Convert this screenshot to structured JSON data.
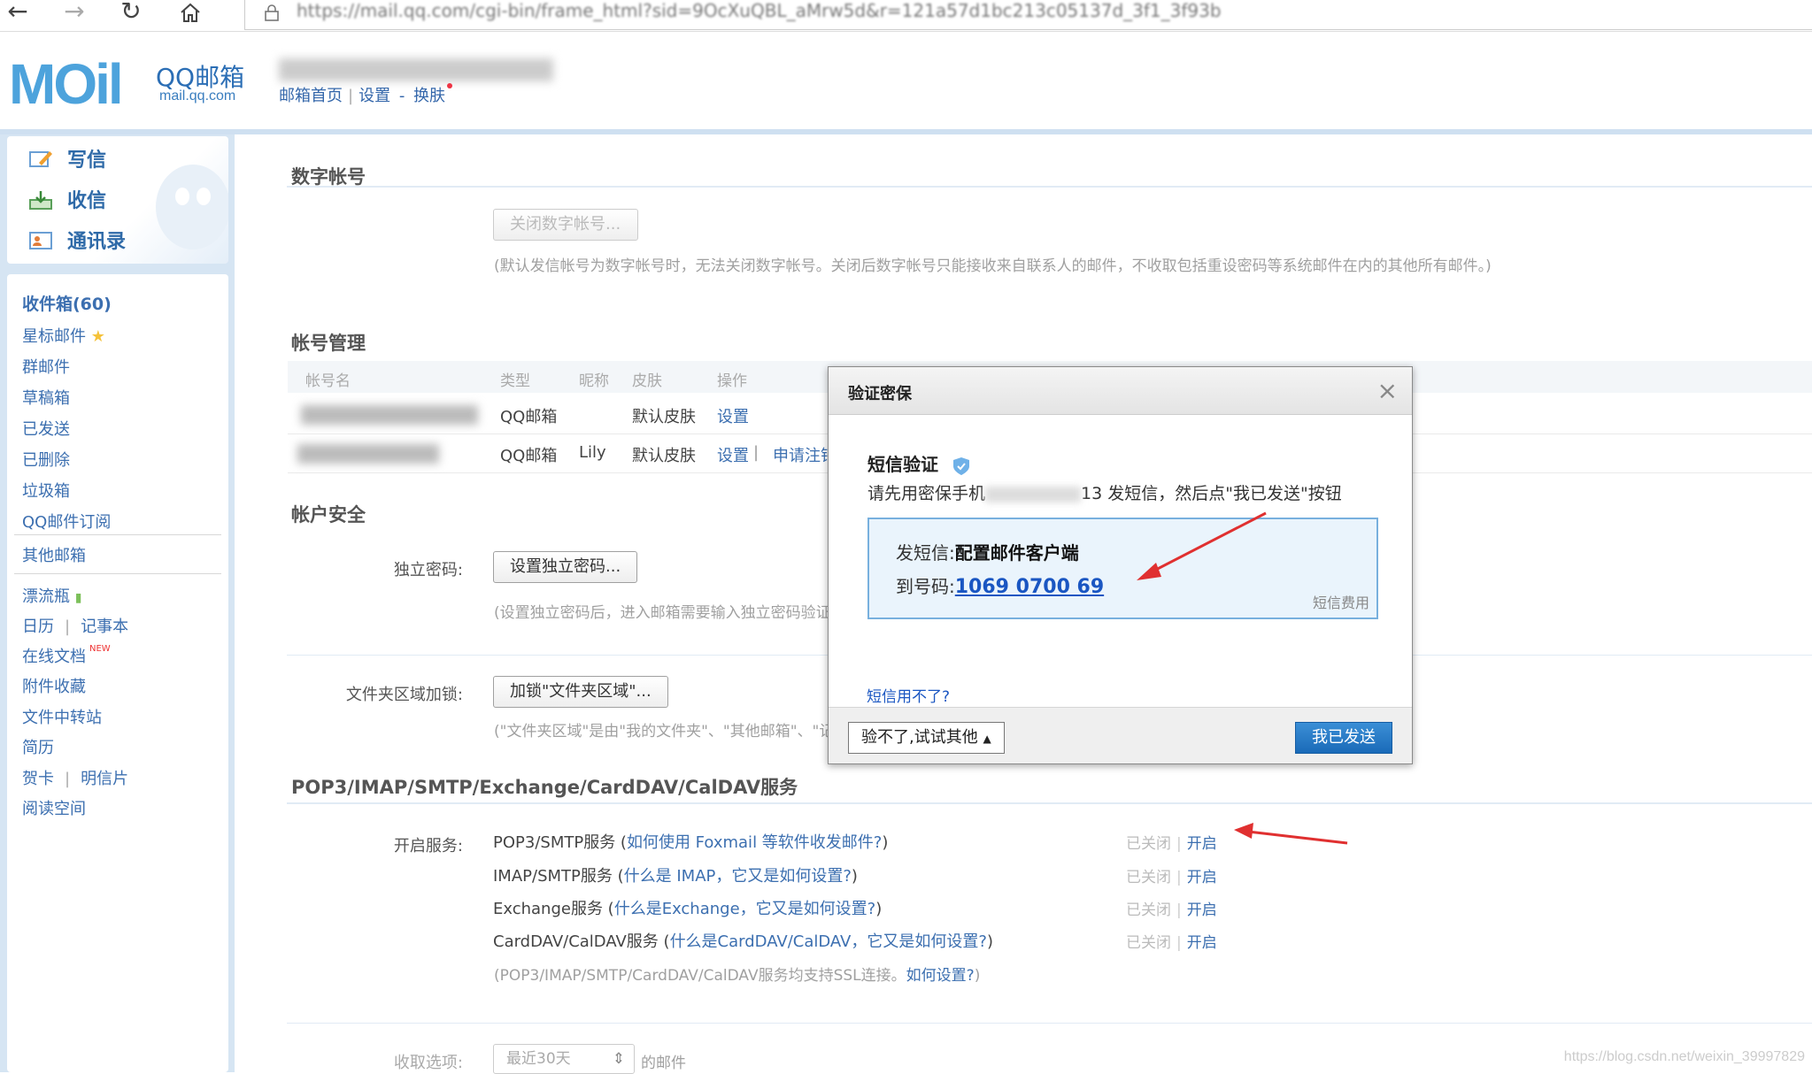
{
  "browser": {
    "url": "https://mail.qq.com/cgi-bin/frame_html?sid=9OcXuQBL_aMrw5d&r=121a57d1bc213c05137d_3f1_3f93b"
  },
  "header": {
    "logo_text": "MOil",
    "logo_brand": "QQ邮箱",
    "logo_url": "mail.qq.com",
    "nav_home": "邮箱首页",
    "nav_settings": "设置",
    "nav_dash": "-",
    "nav_skin": "换肤"
  },
  "sidebar": {
    "actions": [
      {
        "label": "写信",
        "icon": "compose-icon"
      },
      {
        "label": "收信",
        "icon": "inbox-download-icon"
      },
      {
        "label": "通讯录",
        "icon": "contacts-icon"
      }
    ],
    "folders": [
      {
        "label": "收件箱(60)"
      },
      {
        "label": "星标邮件"
      },
      {
        "label": "群邮件"
      },
      {
        "label": "草稿箱"
      },
      {
        "label": "已发送"
      },
      {
        "label": "已删除"
      },
      {
        "label": "垃圾箱"
      },
      {
        "label": "QQ邮件订阅"
      }
    ],
    "other_mail": "其他邮箱",
    "tools": {
      "drift_bottle": "漂流瓶",
      "calendar": "日历",
      "notebook": "记事本",
      "online_docs": "在线文档",
      "new_tag": "NEW",
      "attachments": "附件收藏",
      "file_transfer": "文件中转站",
      "resume": "简历",
      "cards": "贺卡",
      "postcard": "明信片",
      "reading": "阅读空间"
    }
  },
  "sections": {
    "digital": {
      "title": "数字帐号",
      "button": "关闭数字帐号...",
      "note": "(默认发信帐号为数字帐号时，无法关闭数字帐号。关闭后数字帐号只能接收来自联系人的邮件，不收取包括重设密码等系统邮件在内的其他所有邮件。)"
    },
    "accounts": {
      "title": "帐号管理",
      "columns": [
        "帐号名",
        "类型",
        "昵称",
        "皮肤",
        "操作"
      ],
      "rows": [
        {
          "type": "QQ邮箱",
          "nickname": "",
          "skin": "默认皮肤",
          "ops": [
            "设置"
          ]
        },
        {
          "type": "QQ邮箱",
          "nickname": "Lily",
          "skin": "默认皮肤",
          "ops": [
            "设置",
            "申请注销"
          ]
        }
      ]
    },
    "security": {
      "title": "帐户安全",
      "pwd_label": "独立密码:",
      "pwd_button": "设置独立密码...",
      "pwd_note": "(设置独立密码后，进入邮箱需要输入独立密码验证)",
      "folder_label": "文件夹区域加锁:",
      "folder_button": "加锁\"文件夹区域\"...",
      "folder_note": "(\"文件夹区域\"是由\"我的文件夹\"、\"其他邮箱\"、\"记事本\"等组成)"
    },
    "services": {
      "title": "POP3/IMAP/SMTP/Exchange/CardDAV/CalDAV服务",
      "label": "开启服务:",
      "items": [
        {
          "name": "POP3/SMTP服务",
          "link": "如何使用 Foxmail 等软件收发邮件?"
        },
        {
          "name": "IMAP/SMTP服务",
          "link": "什么是 IMAP，它又是如何设置?"
        },
        {
          "name": "Exchange服务",
          "link": "什么是Exchange，它又是如何设置?"
        },
        {
          "name": "CardDAV/CalDAV服务",
          "link": "什么是CardDAV/CalDAV，它又是如何设置?"
        }
      ],
      "status_off": "已关闭",
      "status_sep": "|",
      "status_on": "开启",
      "ssl_note": "(POP3/IMAP/SMTP/CardDAV/CalDAV服务均支持SSL连接。",
      "ssl_link": "如何设置?",
      "receive_label": "收取选项:",
      "receive_value": "最近30天",
      "receive_suffix": "的邮件"
    }
  },
  "dialog": {
    "title": "验证密保",
    "close": "×",
    "subtitle": "短信验证",
    "instruction_pre": "请先用密保手机",
    "instruction_post": "13 发短信，然后点\"我已发送\"按钮",
    "send_label": "发短信:",
    "send_content": "配置邮件客户端",
    "to_label": "到号码:",
    "to_number": "1069 0700 69",
    "fee": "短信费用",
    "cant_use": "短信用不了?",
    "alt_button": "验不了,试试其他",
    "ok_button": "我已发送"
  },
  "watermark": "https://blog.csdn.net/weixin_39997829",
  "colors": {
    "link": "#3c6fb0",
    "accent": "#1a6ab8",
    "sidebar_bg": "#d6e5f3",
    "arrow": "#e03030"
  }
}
